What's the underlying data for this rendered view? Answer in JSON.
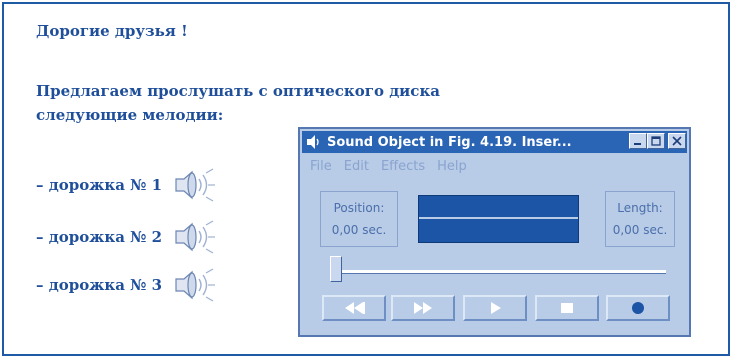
{
  "document": {
    "greeting": "Дорогие друзья !",
    "intro_line1": "Предлагаем прослушать с оптического диска",
    "intro_line2": "следующие мелодии:",
    "tracks": [
      {
        "label": "– дорожка № 1"
      },
      {
        "label": "– дорожка № 2"
      },
      {
        "label": "– дорожка № 3"
      }
    ]
  },
  "sound_window": {
    "title": "Sound Object in Fig. 4.19. Inser...",
    "menu": [
      "File",
      "Edit",
      "Effects",
      "Help"
    ],
    "position_label": "Position:",
    "position_value": "0,00 sec.",
    "length_label": "Length:",
    "length_value": "0,00 sec.",
    "seek_position_fraction": 0,
    "buttons": [
      "rewind",
      "fast-forward",
      "play",
      "stop",
      "record"
    ]
  },
  "colors": {
    "text_blue": "#1f4f9a",
    "window_bg": "#b8cbe7",
    "titlebar": "#2a64b4",
    "display": "#1c55a6"
  },
  "icons": {
    "track_icon": "speaker-icon",
    "window_icon": "speaker-icon"
  }
}
